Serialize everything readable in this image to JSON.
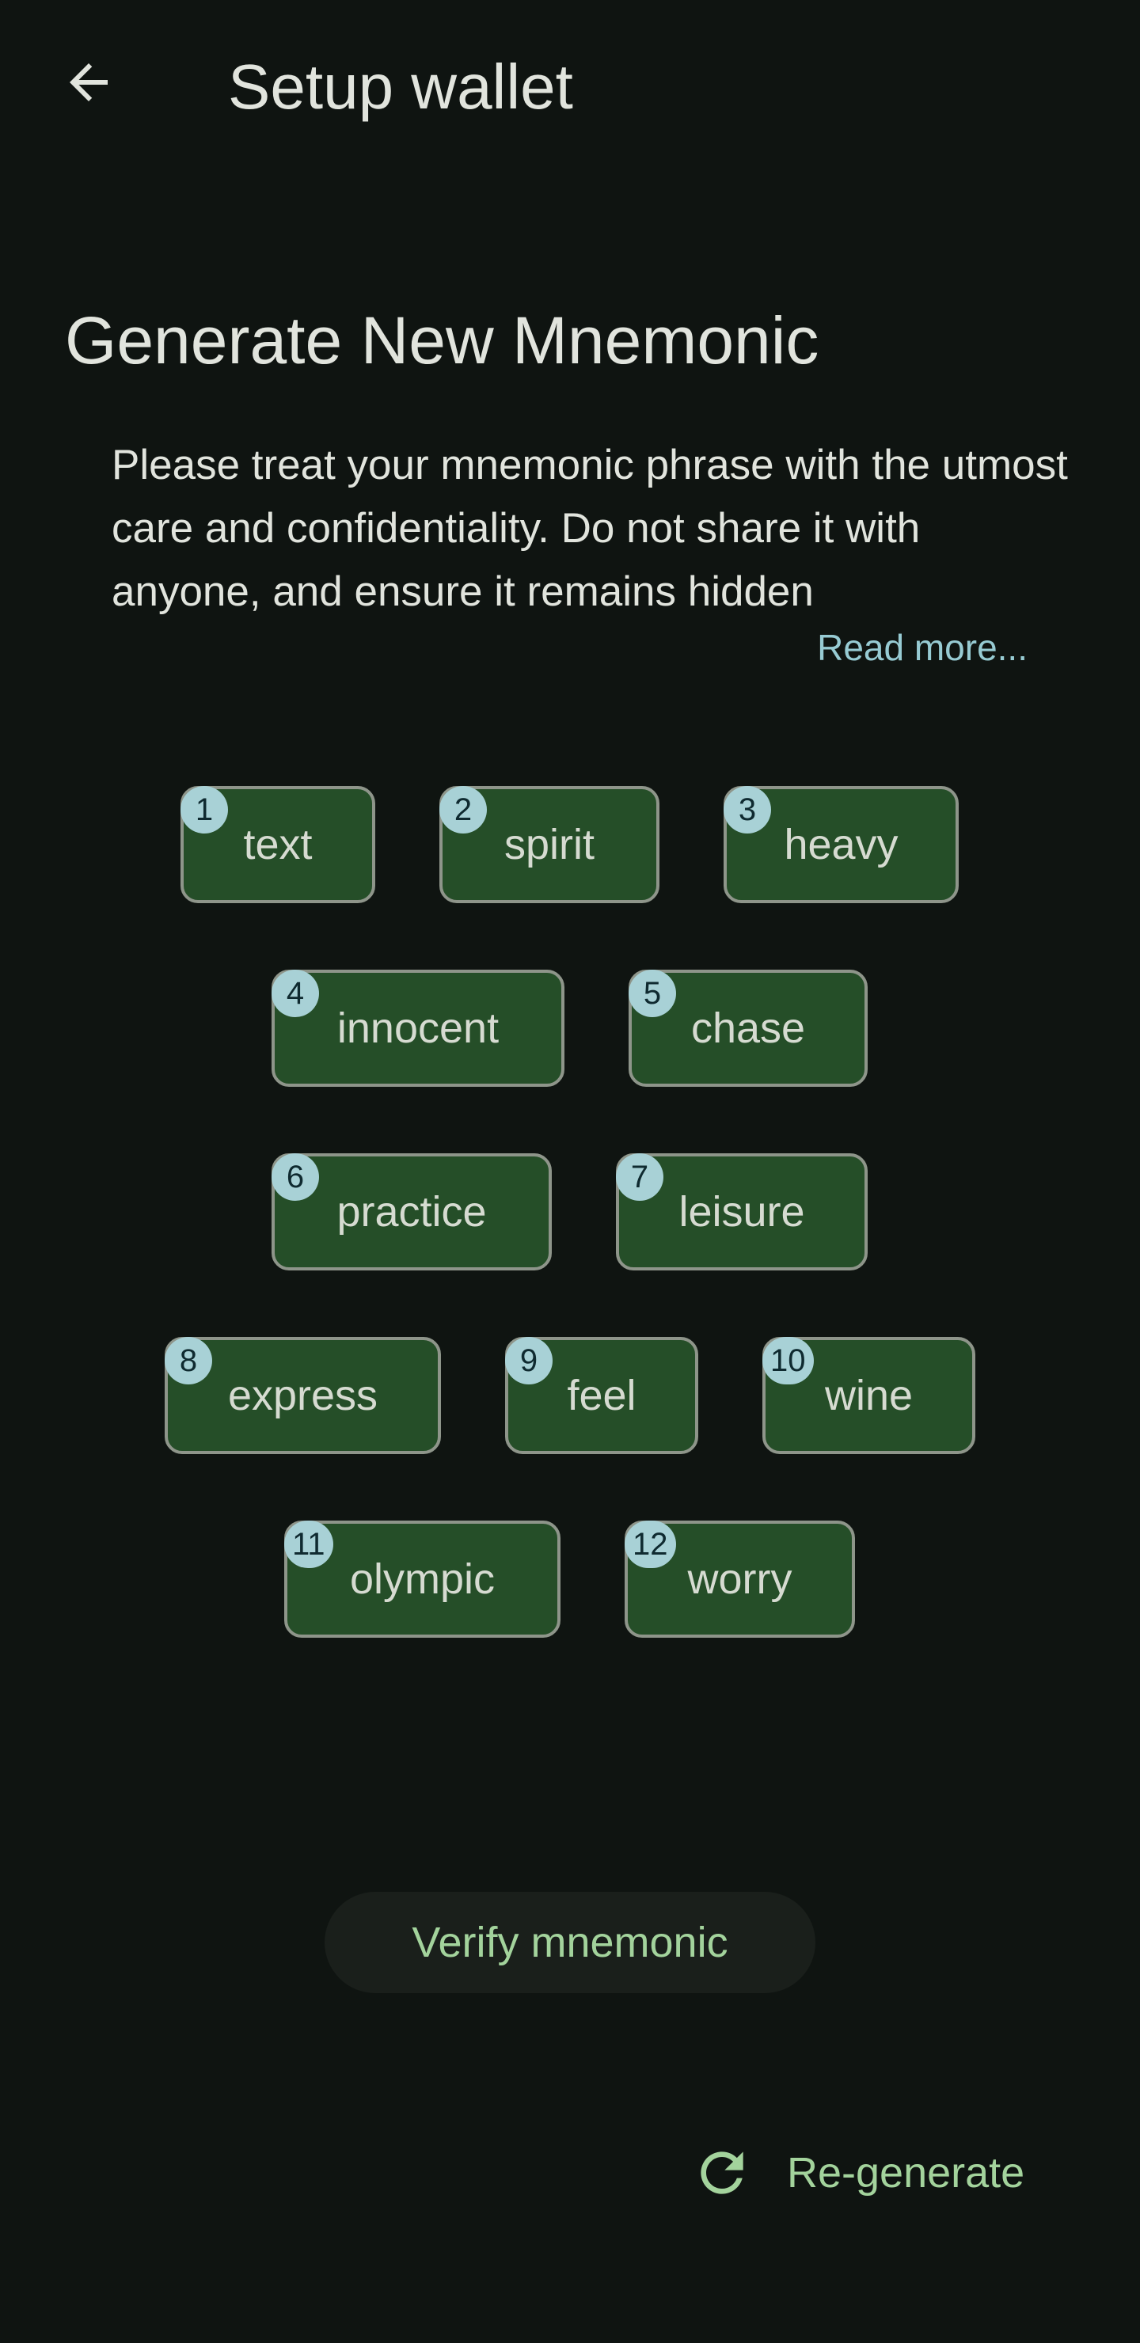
{
  "app_bar": {
    "title": "Setup wallet",
    "back_icon": "arrow-left-icon"
  },
  "main": {
    "heading": "Generate New Mnemonic",
    "description": "Please treat your mnemonic phrase with the utmost care and confidentiality. Do not share it with anyone, and ensure it remains hidden",
    "read_more": "Read more..."
  },
  "mnemonic_words": [
    {
      "index": "1",
      "word": "text"
    },
    {
      "index": "2",
      "word": "spirit"
    },
    {
      "index": "3",
      "word": "heavy"
    },
    {
      "index": "4",
      "word": "innocent"
    },
    {
      "index": "5",
      "word": "chase"
    },
    {
      "index": "6",
      "word": "practice"
    },
    {
      "index": "7",
      "word": "leisure"
    },
    {
      "index": "8",
      "word": "express"
    },
    {
      "index": "9",
      "word": "feel"
    },
    {
      "index": "10",
      "word": "wine"
    },
    {
      "index": "11",
      "word": "olympic"
    },
    {
      "index": "12",
      "word": "worry"
    }
  ],
  "actions": {
    "verify_label": "Verify mnemonic",
    "regenerate_label": "Re-generate",
    "regenerate_icon": "refresh-icon"
  },
  "colors": {
    "background": "#0f1411",
    "chip_fill": "#254e28",
    "chip_border": "#8e958a",
    "badge": "#a8d1d6",
    "accent_green": "#a3d39c",
    "link_blue": "#97cbd3"
  }
}
